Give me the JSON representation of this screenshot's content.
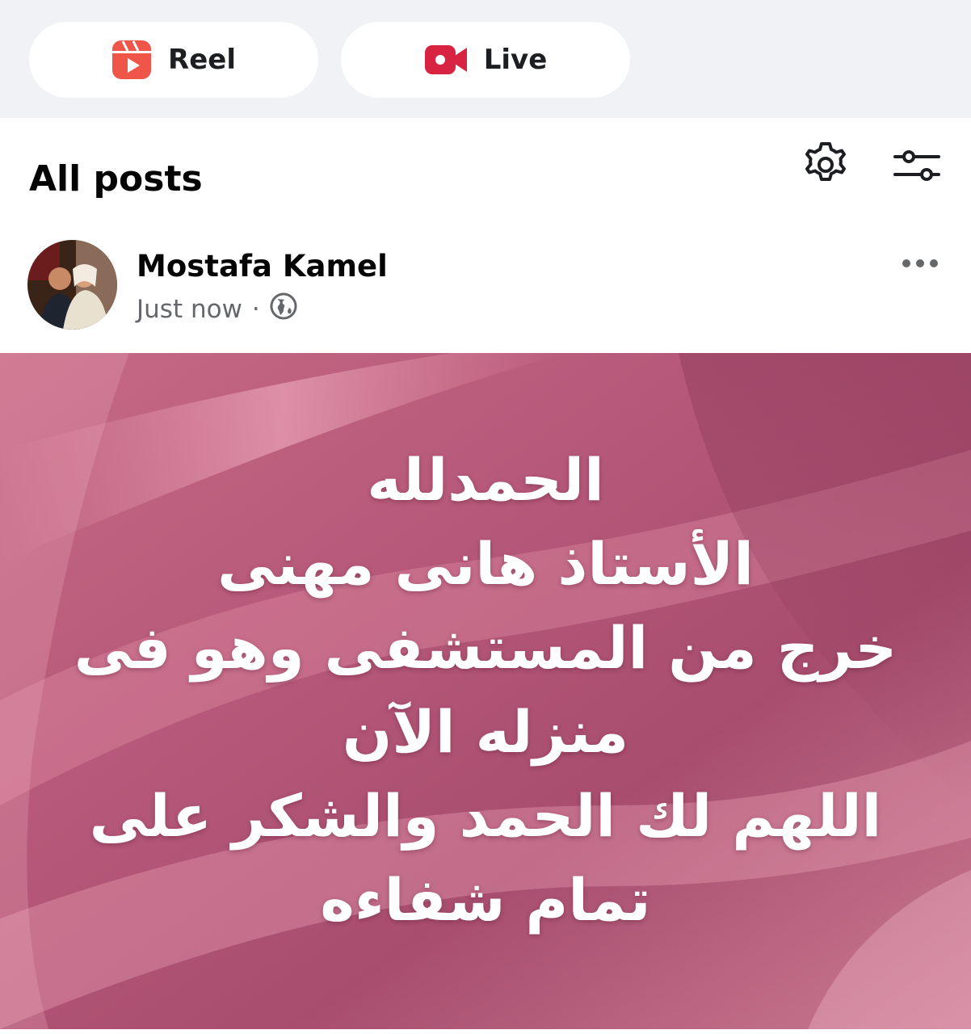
{
  "composer": {
    "reel_label": "Reel",
    "live_label": "Live"
  },
  "feed": {
    "title": "All posts"
  },
  "post": {
    "author": "Mostafa Kamel",
    "time": "Just now",
    "separator": "·",
    "text_lines": [
      "الحمدلله",
      "الأستاذ هانى مهنى",
      "خرج من المستشفى وهو فى",
      "منزله الآن",
      "اللهم لك الحمد والشكر على",
      "تمام شفاءه"
    ]
  },
  "colors": {
    "reel_icon": "#f0554a",
    "live_icon": "#d92342",
    "post_background": "#b25674",
    "meta_text": "#65676b",
    "top_bar": "#f0f2f5"
  },
  "icons": {
    "reel": "reel-icon",
    "live": "video-camera-icon",
    "settings": "gear-icon",
    "filter": "filter-sliders-icon",
    "privacy": "globe-icon",
    "more": "more-dots-icon"
  }
}
